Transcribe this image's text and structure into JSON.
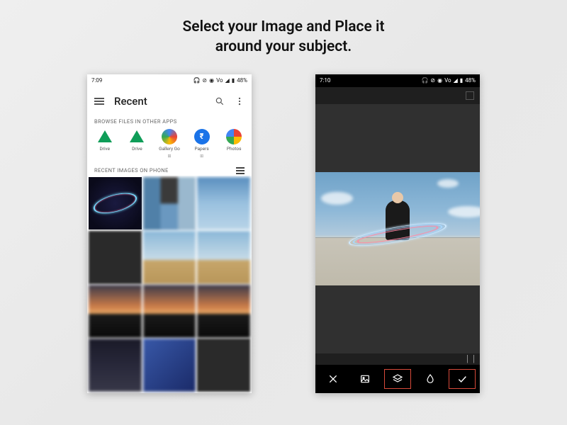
{
  "headline": {
    "line1": "Select your Image and Place it",
    "line2": "around your subject."
  },
  "light_phone": {
    "status": {
      "time": "7:09",
      "battery": "48%",
      "carrier": "Vo"
    },
    "appbar": {
      "title": "Recent"
    },
    "section_browse": "BROWSE FILES IN OTHER APPS",
    "apps": [
      {
        "label": "Drive",
        "icon": "drive",
        "color": "#0f9d58"
      },
      {
        "label": "Drive",
        "icon": "drive",
        "color": "#0f9d58"
      },
      {
        "label": "Gallery Go",
        "icon": "gallery",
        "color": "#4285f4"
      },
      {
        "label": "Papers",
        "icon": "papers",
        "color": "#1a73e8"
      },
      {
        "label": "Photos",
        "icon": "photos",
        "color": "#ea4335"
      }
    ],
    "section_recent": "RECENT IMAGES ON PHONE"
  },
  "dark_phone": {
    "status": {
      "time": "7:10",
      "battery": "48%",
      "carrier": "Vo"
    },
    "toolbar": {
      "close": "close",
      "image": "image",
      "layers": "layers",
      "opacity": "opacity",
      "confirm": "confirm"
    }
  }
}
